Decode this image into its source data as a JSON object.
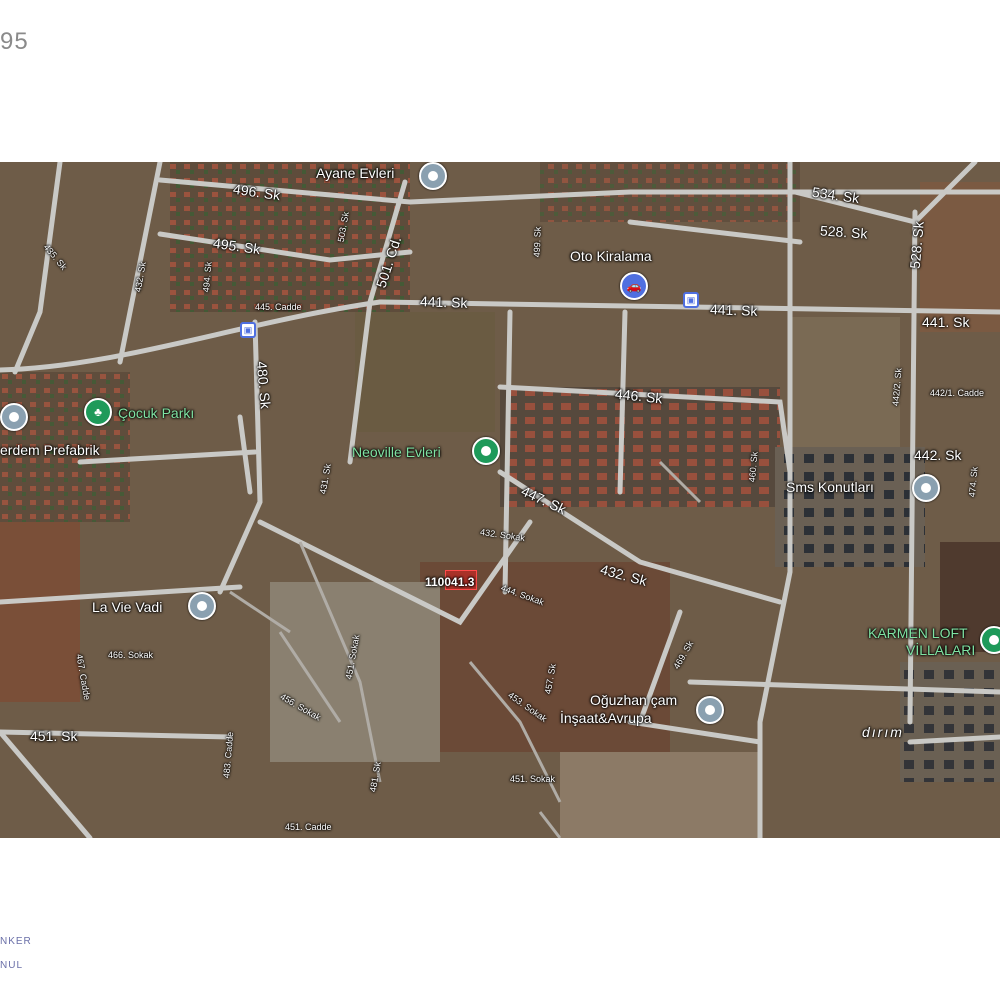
{
  "header": {
    "corner_number": "95"
  },
  "map": {
    "roads": {
      "r496": "496. Sk",
      "r495": "495. Sk",
      "r494": "494. Sk",
      "r432a": "432. Sk",
      "r503": "503. Sk",
      "r501": "501. Cd.",
      "r441a": "441. Sk",
      "r441b": "441. Sk",
      "r441c": "441. Sk",
      "r499": "499. Sk",
      "r534": "534. Sk",
      "r528a": "528. Sk",
      "r528b": "528. Sk",
      "r446": "446. Sk",
      "r447": "447. Sk",
      "r432b": "432. Sk",
      "r480": "480. Sk",
      "r442a": "442. Sk",
      "r4422": "442/2. Sk",
      "r442_1": "442/1. Cadde",
      "r474": "474. Sk",
      "r451": "451. Sk",
      "r460": "460. Sk",
      "r431": "431. Sk",
      "r444": "444. Sokak",
      "r432s": "432. Sokak",
      "r469": "469. Sk",
      "r457": "457. Sk",
      "r456": "456. Sokak",
      "r483": "483. Cadde",
      "r451s": "451. Sokak",
      "r453": "453. Sokak",
      "r451c": "451. Cadde",
      "r466": "466. Sokak",
      "r467": "467. Cadde",
      "r445": "445. Cadde",
      "r435": "435. Sk",
      "r481": "481. Sk"
    },
    "places": {
      "ayane": "Ayane Evleri",
      "oto": "Oto Kiralama",
      "cocuk": "Çocuk Parkı",
      "erdem": "erdem Prefabrik",
      "neoville": "Neoville Evleri",
      "sms": "Sms Konutları",
      "lavie": "La Vie Vadi",
      "karmen1": "KARMEN LOFT",
      "karmen2": "VİLLALARI",
      "oguzhan1": "Oğuzhan çam",
      "oguzhan2": "İnşaat&Avrupa",
      "dirim": "dırım"
    },
    "parcel_label": "110041.3",
    "pin_colors": {
      "grey": "#8aa0b0",
      "green": "#1e9a5a",
      "blue": "#4f6fe0"
    }
  },
  "footer": {
    "line1": "NKER",
    "line2": "NUL"
  }
}
